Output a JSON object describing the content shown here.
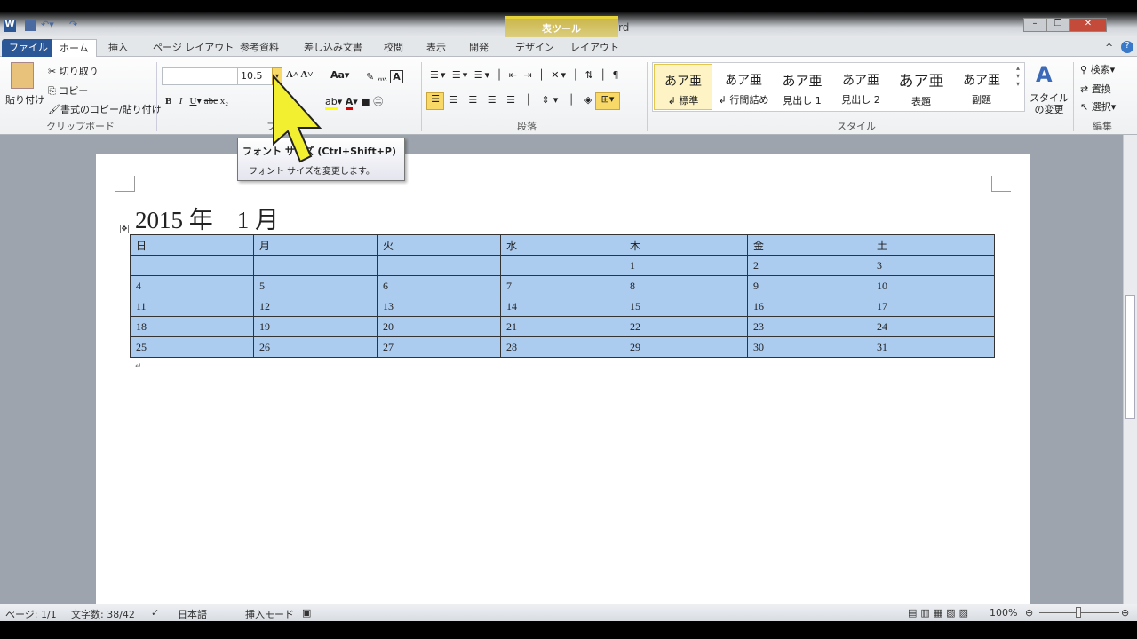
{
  "window": {
    "title": "文書 1 - Microsoft Word",
    "contextual_tab_group": "表ツール"
  },
  "tabs": [
    "ファイル",
    "ホーム",
    "挿入",
    "ページ レイアウト",
    "参考資料",
    "差し込み文書",
    "校閲",
    "表示",
    "開発",
    "デザイン",
    "レイアウト"
  ],
  "clipboard": {
    "paste": "貼り付け",
    "cut": "切り取り",
    "copy": "コピー",
    "format_painter": "書式のコピー/貼り付け",
    "group": "クリップボード"
  },
  "font": {
    "name_value": "",
    "size_value": "10.5",
    "group": "フォント",
    "buttons": [
      "B",
      "I",
      "U",
      "abc",
      "x₂",
      "A"
    ]
  },
  "paragraph": {
    "group": "段落"
  },
  "styles": {
    "items": [
      {
        "sample": "あア亜",
        "name": "↲ 標準"
      },
      {
        "sample": "あア亜",
        "name": "↲ 行間詰め"
      },
      {
        "sample": "あア亜",
        "name": "見出し 1"
      },
      {
        "sample": "あア亜",
        "name": "見出し 2"
      },
      {
        "sample": "あア亜",
        "name": "表題"
      },
      {
        "sample": "あア亜",
        "name": "副題"
      }
    ],
    "change": "スタイルの変更",
    "group": "スタイル"
  },
  "editing": {
    "find": "検索",
    "replace": "置換",
    "select": "選択",
    "group": "編集"
  },
  "tooltip": {
    "title": "フォント サイズ (Ctrl+Shift+P)",
    "desc": "フォント サイズを変更します。"
  },
  "document": {
    "heading": "2015 年　1 月",
    "calendar": [
      [
        "日",
        "月",
        "火",
        "水",
        "木",
        "金",
        "土"
      ],
      [
        "",
        "",
        "",
        "",
        "1",
        "2",
        "3"
      ],
      [
        "4",
        "5",
        "6",
        "7",
        "8",
        "9",
        "10"
      ],
      [
        "11",
        "12",
        "13",
        "14",
        "15",
        "16",
        "17"
      ],
      [
        "18",
        "19",
        "20",
        "21",
        "22",
        "23",
        "24"
      ],
      [
        "25",
        "26",
        "27",
        "28",
        "29",
        "30",
        "31"
      ]
    ]
  },
  "status": {
    "page": "ページ: 1/1",
    "words": "文字数: 38/42",
    "language": "日本語",
    "mode": "挿入モード",
    "zoom": "100%"
  },
  "colors": {
    "selection": "#abcbef",
    "file_tab": "#2b5797",
    "table_tools": "#e6d23a"
  }
}
